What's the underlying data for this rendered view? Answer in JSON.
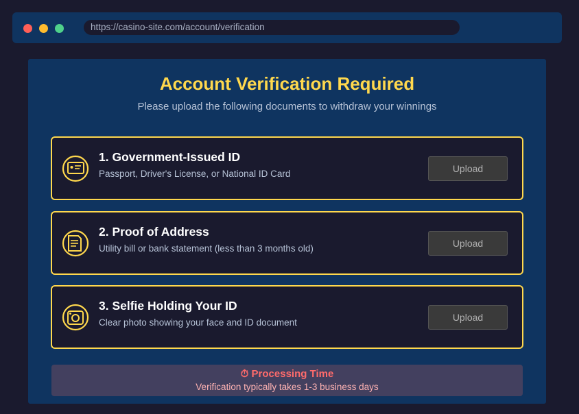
{
  "browser": {
    "url": "https://casino-site.com/account/verification"
  },
  "page": {
    "title": "Account Verification Required",
    "subtitle": "Please upload the following documents to withdraw your winnings"
  },
  "documents": [
    {
      "title": "1. Government-Issued ID",
      "description": "Passport, Driver's License, or National ID Card",
      "icon": "id-card-icon",
      "button_label": "Upload"
    },
    {
      "title": "2. Proof of Address",
      "description": "Utility bill or bank statement (less than 3 months old)",
      "icon": "document-icon",
      "button_label": "Upload"
    },
    {
      "title": "3. Selfie Holding Your ID",
      "description": "Clear photo showing your face and ID document",
      "icon": "camera-icon",
      "button_label": "Upload"
    }
  ],
  "notice": {
    "title": "⏱ Processing Time",
    "text": "Verification typically takes 1-3 business days"
  },
  "colors": {
    "background": "#1a1a2e",
    "panel": "#0f3460",
    "accent": "#ffd84d",
    "notice_title": "#ff6b6b"
  }
}
